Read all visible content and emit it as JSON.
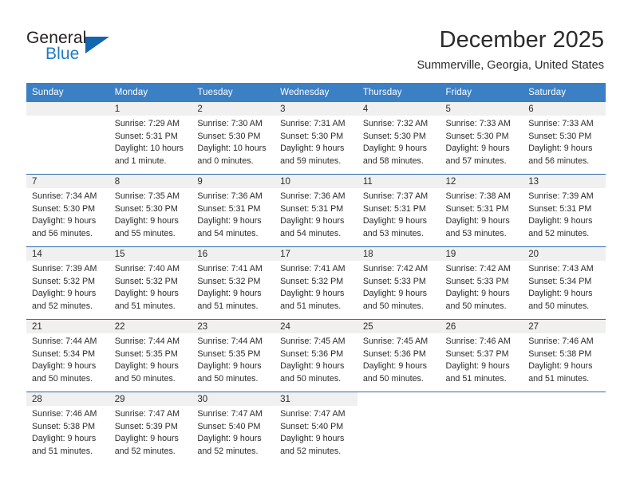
{
  "brand": {
    "word_one": "General",
    "word_two": "Blue",
    "logo_icon": "triangle-logo-icon"
  },
  "header": {
    "month_title": "December 2025",
    "location": "Summerville, Georgia, United States"
  },
  "colors": {
    "header_blue": "#3b7fc4",
    "separator_blue": "#2d6ca8",
    "daynum_band": "#f0f0f0",
    "brand_blue": "#1d7bc4",
    "text": "#2b2b2b"
  },
  "weekdays": [
    "Sunday",
    "Monday",
    "Tuesday",
    "Wednesday",
    "Thursday",
    "Friday",
    "Saturday"
  ],
  "weeks": [
    [
      {
        "day": "",
        "lines": []
      },
      {
        "day": "1",
        "lines": [
          "Sunrise: 7:29 AM",
          "Sunset: 5:31 PM",
          "Daylight: 10 hours",
          "and 1 minute."
        ]
      },
      {
        "day": "2",
        "lines": [
          "Sunrise: 7:30 AM",
          "Sunset: 5:30 PM",
          "Daylight: 10 hours",
          "and 0 minutes."
        ]
      },
      {
        "day": "3",
        "lines": [
          "Sunrise: 7:31 AM",
          "Sunset: 5:30 PM",
          "Daylight: 9 hours",
          "and 59 minutes."
        ]
      },
      {
        "day": "4",
        "lines": [
          "Sunrise: 7:32 AM",
          "Sunset: 5:30 PM",
          "Daylight: 9 hours",
          "and 58 minutes."
        ]
      },
      {
        "day": "5",
        "lines": [
          "Sunrise: 7:33 AM",
          "Sunset: 5:30 PM",
          "Daylight: 9 hours",
          "and 57 minutes."
        ]
      },
      {
        "day": "6",
        "lines": [
          "Sunrise: 7:33 AM",
          "Sunset: 5:30 PM",
          "Daylight: 9 hours",
          "and 56 minutes."
        ]
      }
    ],
    [
      {
        "day": "7",
        "lines": [
          "Sunrise: 7:34 AM",
          "Sunset: 5:30 PM",
          "Daylight: 9 hours",
          "and 56 minutes."
        ]
      },
      {
        "day": "8",
        "lines": [
          "Sunrise: 7:35 AM",
          "Sunset: 5:30 PM",
          "Daylight: 9 hours",
          "and 55 minutes."
        ]
      },
      {
        "day": "9",
        "lines": [
          "Sunrise: 7:36 AM",
          "Sunset: 5:31 PM",
          "Daylight: 9 hours",
          "and 54 minutes."
        ]
      },
      {
        "day": "10",
        "lines": [
          "Sunrise: 7:36 AM",
          "Sunset: 5:31 PM",
          "Daylight: 9 hours",
          "and 54 minutes."
        ]
      },
      {
        "day": "11",
        "lines": [
          "Sunrise: 7:37 AM",
          "Sunset: 5:31 PM",
          "Daylight: 9 hours",
          "and 53 minutes."
        ]
      },
      {
        "day": "12",
        "lines": [
          "Sunrise: 7:38 AM",
          "Sunset: 5:31 PM",
          "Daylight: 9 hours",
          "and 53 minutes."
        ]
      },
      {
        "day": "13",
        "lines": [
          "Sunrise: 7:39 AM",
          "Sunset: 5:31 PM",
          "Daylight: 9 hours",
          "and 52 minutes."
        ]
      }
    ],
    [
      {
        "day": "14",
        "lines": [
          "Sunrise: 7:39 AM",
          "Sunset: 5:32 PM",
          "Daylight: 9 hours",
          "and 52 minutes."
        ]
      },
      {
        "day": "15",
        "lines": [
          "Sunrise: 7:40 AM",
          "Sunset: 5:32 PM",
          "Daylight: 9 hours",
          "and 51 minutes."
        ]
      },
      {
        "day": "16",
        "lines": [
          "Sunrise: 7:41 AM",
          "Sunset: 5:32 PM",
          "Daylight: 9 hours",
          "and 51 minutes."
        ]
      },
      {
        "day": "17",
        "lines": [
          "Sunrise: 7:41 AM",
          "Sunset: 5:32 PM",
          "Daylight: 9 hours",
          "and 51 minutes."
        ]
      },
      {
        "day": "18",
        "lines": [
          "Sunrise: 7:42 AM",
          "Sunset: 5:33 PM",
          "Daylight: 9 hours",
          "and 50 minutes."
        ]
      },
      {
        "day": "19",
        "lines": [
          "Sunrise: 7:42 AM",
          "Sunset: 5:33 PM",
          "Daylight: 9 hours",
          "and 50 minutes."
        ]
      },
      {
        "day": "20",
        "lines": [
          "Sunrise: 7:43 AM",
          "Sunset: 5:34 PM",
          "Daylight: 9 hours",
          "and 50 minutes."
        ]
      }
    ],
    [
      {
        "day": "21",
        "lines": [
          "Sunrise: 7:44 AM",
          "Sunset: 5:34 PM",
          "Daylight: 9 hours",
          "and 50 minutes."
        ]
      },
      {
        "day": "22",
        "lines": [
          "Sunrise: 7:44 AM",
          "Sunset: 5:35 PM",
          "Daylight: 9 hours",
          "and 50 minutes."
        ]
      },
      {
        "day": "23",
        "lines": [
          "Sunrise: 7:44 AM",
          "Sunset: 5:35 PM",
          "Daylight: 9 hours",
          "and 50 minutes."
        ]
      },
      {
        "day": "24",
        "lines": [
          "Sunrise: 7:45 AM",
          "Sunset: 5:36 PM",
          "Daylight: 9 hours",
          "and 50 minutes."
        ]
      },
      {
        "day": "25",
        "lines": [
          "Sunrise: 7:45 AM",
          "Sunset: 5:36 PM",
          "Daylight: 9 hours",
          "and 50 minutes."
        ]
      },
      {
        "day": "26",
        "lines": [
          "Sunrise: 7:46 AM",
          "Sunset: 5:37 PM",
          "Daylight: 9 hours",
          "and 51 minutes."
        ]
      },
      {
        "day": "27",
        "lines": [
          "Sunrise: 7:46 AM",
          "Sunset: 5:38 PM",
          "Daylight: 9 hours",
          "and 51 minutes."
        ]
      }
    ],
    [
      {
        "day": "28",
        "lines": [
          "Sunrise: 7:46 AM",
          "Sunset: 5:38 PM",
          "Daylight: 9 hours",
          "and 51 minutes."
        ]
      },
      {
        "day": "29",
        "lines": [
          "Sunrise: 7:47 AM",
          "Sunset: 5:39 PM",
          "Daylight: 9 hours",
          "and 52 minutes."
        ]
      },
      {
        "day": "30",
        "lines": [
          "Sunrise: 7:47 AM",
          "Sunset: 5:40 PM",
          "Daylight: 9 hours",
          "and 52 minutes."
        ]
      },
      {
        "day": "31",
        "lines": [
          "Sunrise: 7:47 AM",
          "Sunset: 5:40 PM",
          "Daylight: 9 hours",
          "and 52 minutes."
        ]
      },
      {
        "day": "",
        "lines": []
      },
      {
        "day": "",
        "lines": []
      },
      {
        "day": "",
        "lines": []
      }
    ]
  ]
}
